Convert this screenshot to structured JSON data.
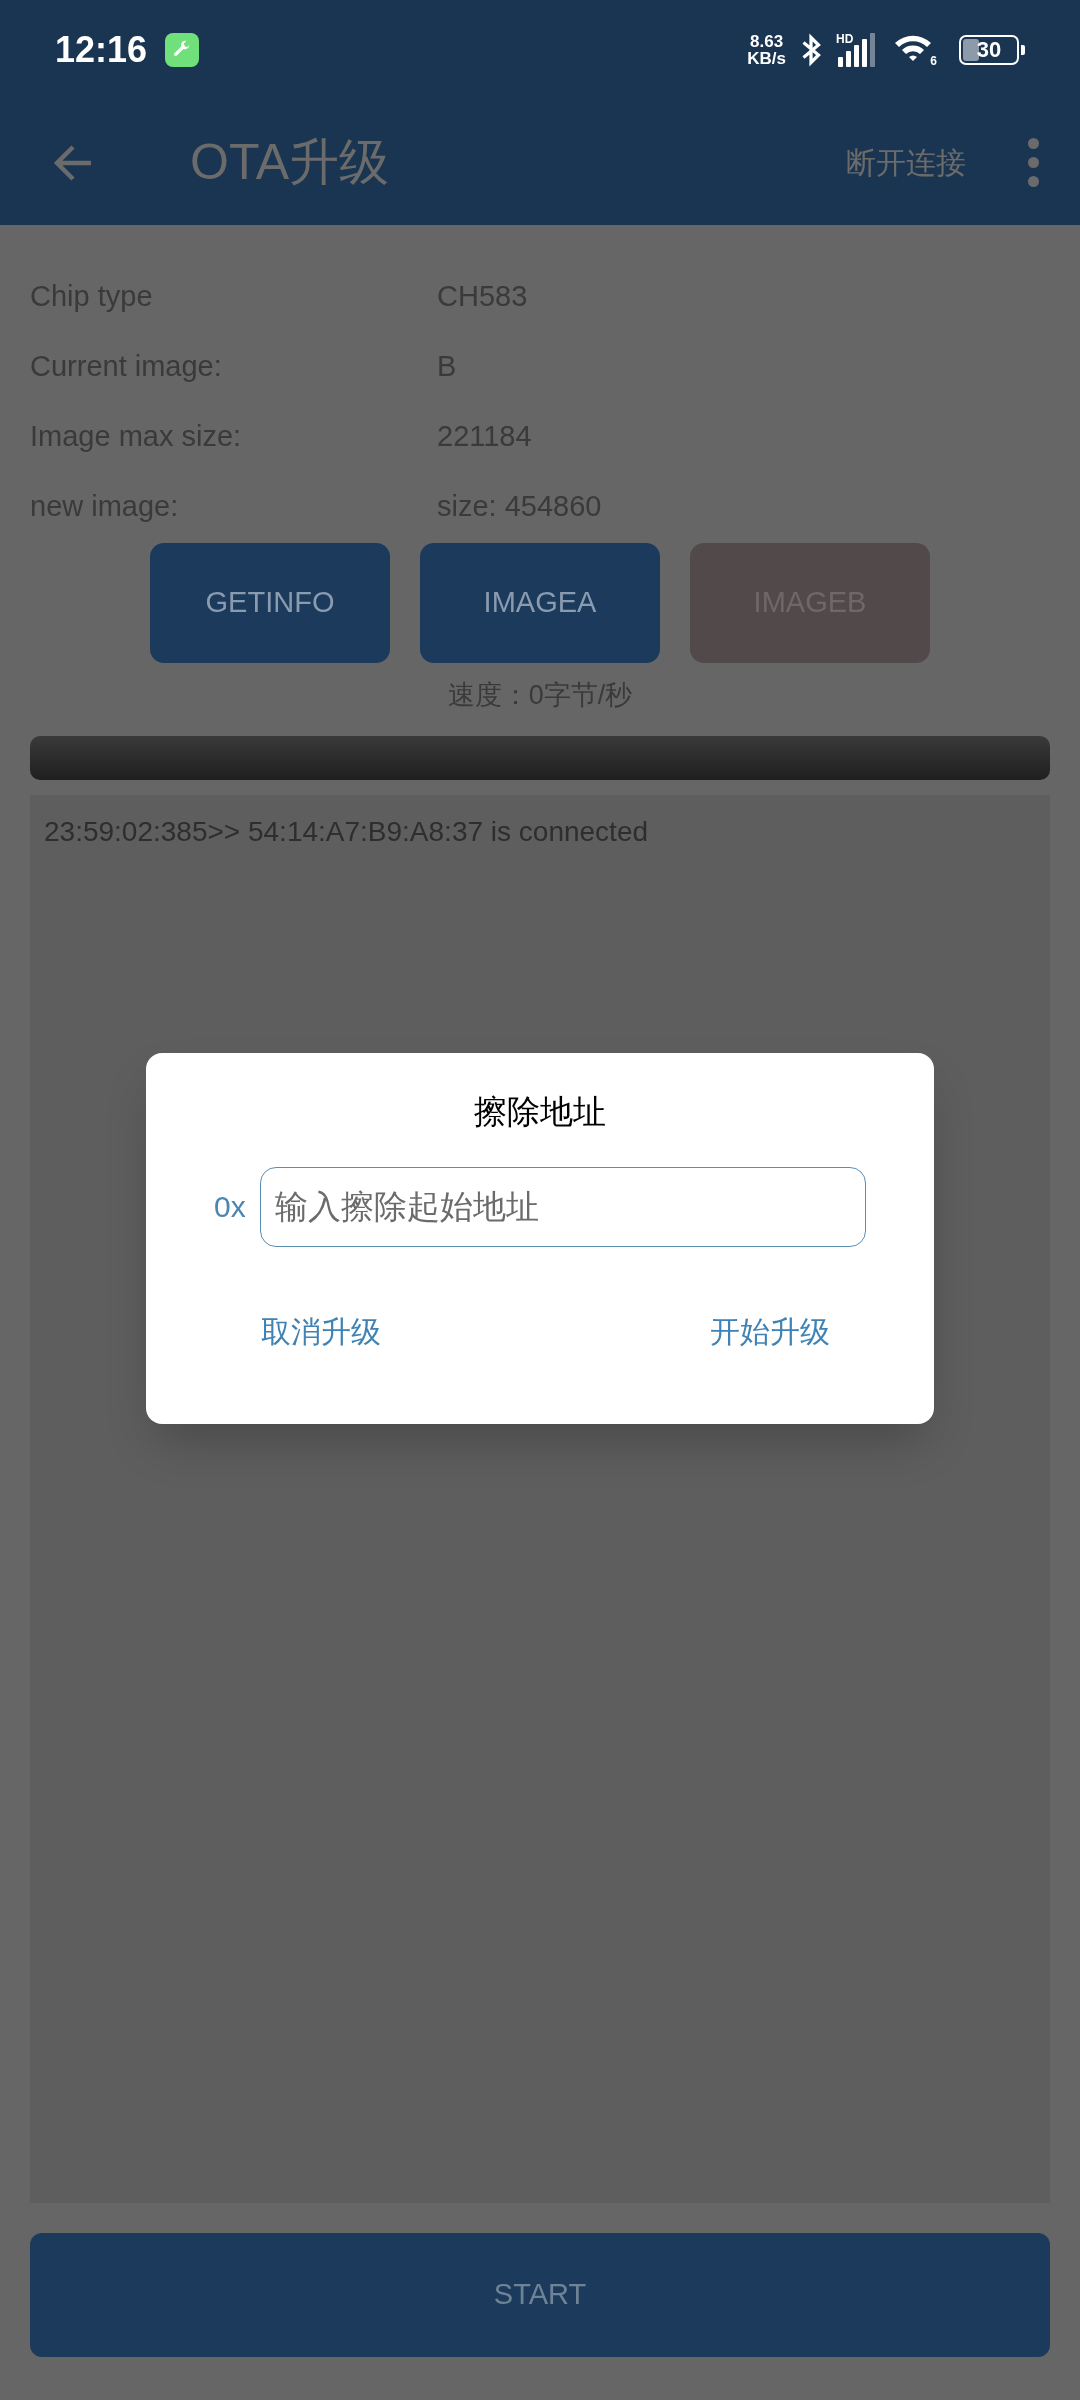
{
  "status_bar": {
    "time": "12:16",
    "speed_value": "8.63",
    "speed_unit": "KB/s",
    "signal_label": "HD",
    "wifi_label": "6",
    "battery": "30"
  },
  "app_bar": {
    "title": "OTA升级",
    "action": "断开连接"
  },
  "info": [
    {
      "label": "Chip type",
      "value": "CH583"
    },
    {
      "label": "Current image:",
      "value": "B"
    },
    {
      "label": "Image max size:",
      "value": "221184"
    },
    {
      "label": "new image:",
      "value": "size: 454860"
    }
  ],
  "buttons": [
    {
      "label": "GETINFO",
      "disabled": false
    },
    {
      "label": "IMAGEA",
      "disabled": false
    },
    {
      "label": "IMAGEB",
      "disabled": true
    }
  ],
  "speed": "速度：0字节/秒",
  "progress": {
    "level": 0
  },
  "log": [
    "23:59:02:385>> 54:14:A7:B9:A8:37 is connected"
  ],
  "dialog": {
    "title": "擦除地址",
    "prefix": "0x",
    "placeholder": "输入擦除起始地址",
    "buttons": [
      "取消升级",
      "开始升级"
    ]
  },
  "start_button": {
    "label": "START"
  }
}
